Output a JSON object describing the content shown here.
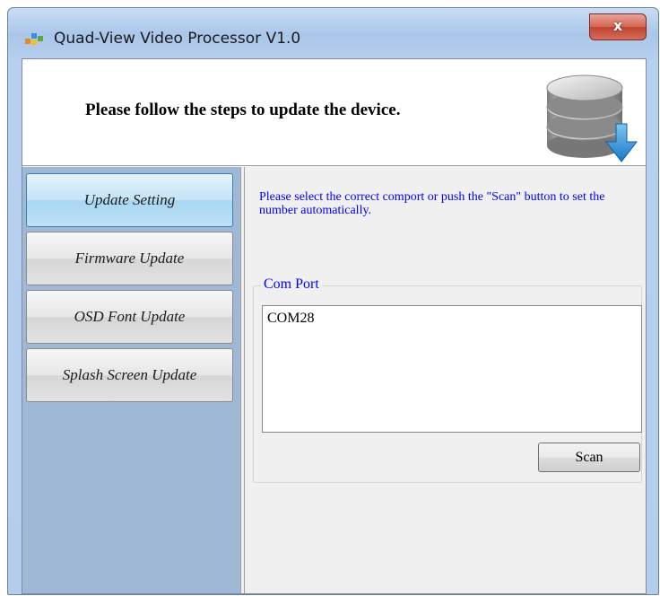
{
  "window": {
    "title": "Quad-View Video Processor V1.0",
    "close_glyph": "x"
  },
  "header": {
    "text": "Please follow the steps to update the device.",
    "icon": "database-download-icon"
  },
  "nav": {
    "items": [
      {
        "label": "Update Setting",
        "active": true
      },
      {
        "label": "Firmware Update",
        "active": false
      },
      {
        "label": "OSD Font Update",
        "active": false
      },
      {
        "label": "Splash Screen Update",
        "active": false
      }
    ]
  },
  "content": {
    "instruction": "Please select the correct comport or push the \"Scan\" button to set the number automatically.",
    "com_port": {
      "label": "Com Port",
      "items": [
        "COM28"
      ]
    },
    "scan_label": "Scan"
  },
  "colors": {
    "nav_background": "#9eb8d6",
    "instruction_text": "#0000ff",
    "active_button": "#a8d6f2"
  }
}
